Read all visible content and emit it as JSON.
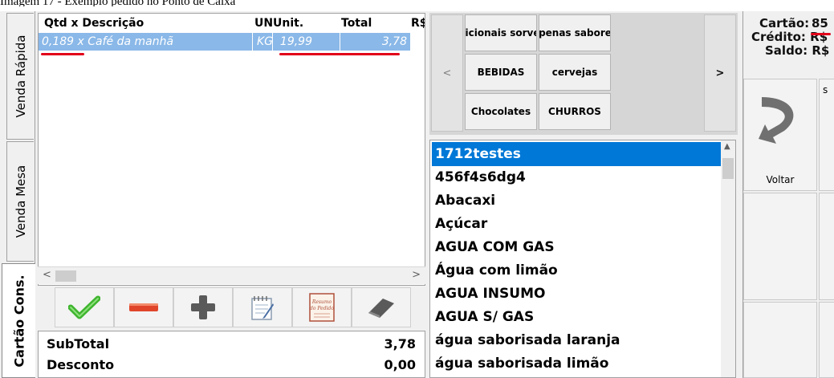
{
  "caption": "Imagem 17 - Exemplo pedido no Ponto de Caixa",
  "tabs": [
    {
      "label": "Venda Rápida"
    },
    {
      "label": "Venda Mesa"
    },
    {
      "label": "Cartão Cons."
    }
  ],
  "order_grid": {
    "columns": [
      "Qtd x Descrição",
      "UN",
      "Unit.",
      "Total",
      "R$"
    ],
    "rows": [
      {
        "desc": "0,189 x Café da manhã",
        "un": "KG",
        "unit": "19,99",
        "total": "3,78"
      }
    ]
  },
  "toolbar": {
    "buttons": [
      {
        "icon": "checkmark-icon"
      },
      {
        "icon": "minus-icon"
      },
      {
        "icon": "plus-icon"
      },
      {
        "icon": "notepad-icon"
      },
      {
        "icon": "order-summary-icon",
        "text": "Resumo do Pedido"
      },
      {
        "icon": "eraser-icon"
      }
    ]
  },
  "totals": {
    "subtotal_label": "SubTotal",
    "subtotal_value": "3,78",
    "desconto_label": "Desconto",
    "desconto_value": "0,00"
  },
  "categories": {
    "prev": "<",
    "next": ">",
    "buttons": [
      "Adicionais sorvete",
      "apenas sabores",
      "BEBIDAS",
      "cervejas",
      "Chocolates",
      "CHURROS"
    ]
  },
  "products": [
    "1712testes",
    "456f4s6dg4",
    "Abacaxi",
    "Açúcar",
    "AGUA COM GAS",
    "Água com limão",
    "AGUA INSUMO",
    "AGUA S/ GAS",
    "água saborisada laranja",
    "água saborisada limão"
  ],
  "card": {
    "cartao_label": "Cartão:",
    "cartao_number": "85",
    "credito_label": "Crédito: R$",
    "saldo_label": "Saldo: R$"
  },
  "side_buttons": {
    "voltar": "Voltar",
    "top_right_fragment": "s"
  },
  "colors": {
    "selection_blue": "#0078d7",
    "row_highlight": "#8ab8e8",
    "underline_red": "#e2001a",
    "check_green": "#3fb52f",
    "minus_red": "#e0452a"
  }
}
